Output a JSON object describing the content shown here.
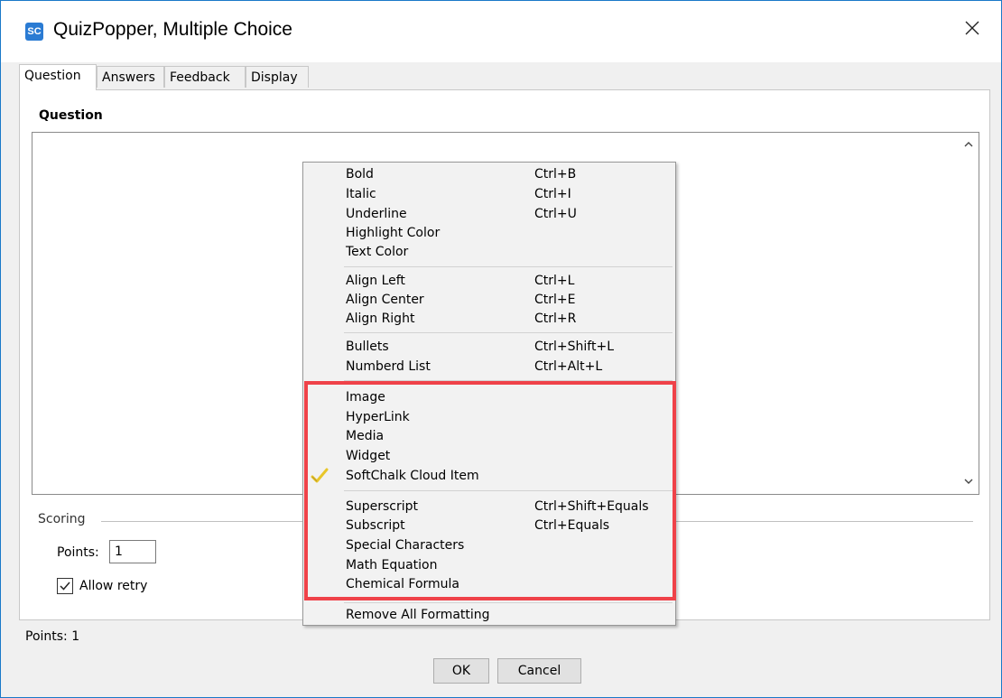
{
  "window": {
    "title": "QuizPopper, Multiple Choice",
    "app_icon_text": "SC"
  },
  "tabs": [
    {
      "label": "Question",
      "active": true
    },
    {
      "label": "Answers",
      "active": false
    },
    {
      "label": "Feedback",
      "active": false
    },
    {
      "label": "Display",
      "active": false
    }
  ],
  "question": {
    "heading": "Question"
  },
  "context_menu": {
    "groups": [
      [
        {
          "label": "Bold",
          "shortcut": "Ctrl+B"
        },
        {
          "label": "Italic",
          "shortcut": "Ctrl+I"
        },
        {
          "label": "Underline",
          "shortcut": "Ctrl+U"
        },
        {
          "label": "Highlight Color",
          "shortcut": ""
        },
        {
          "label": "Text Color",
          "shortcut": ""
        }
      ],
      [
        {
          "label": "Align Left",
          "shortcut": "Ctrl+L"
        },
        {
          "label": "Align Center",
          "shortcut": "Ctrl+E"
        },
        {
          "label": "Align Right",
          "shortcut": "Ctrl+R"
        }
      ],
      [
        {
          "label": "Bullets",
          "shortcut": "Ctrl+Shift+L"
        },
        {
          "label": "Numberd List",
          "shortcut": "Ctrl+Alt+L"
        }
      ],
      [
        {
          "label": "Image",
          "shortcut": ""
        },
        {
          "label": "HyperLink",
          "shortcut": ""
        },
        {
          "label": "Media",
          "shortcut": ""
        },
        {
          "label": "Widget",
          "shortcut": ""
        },
        {
          "label": "SoftChalk Cloud Item",
          "shortcut": "",
          "icon": "cloud-check-icon"
        }
      ],
      [
        {
          "label": "Superscript",
          "shortcut": "Ctrl+Shift+Equals"
        },
        {
          "label": "Subscript",
          "shortcut": "Ctrl+Equals"
        },
        {
          "label": "Special Characters",
          "shortcut": ""
        },
        {
          "label": "Math Equation",
          "shortcut": ""
        },
        {
          "label": "Chemical Formula",
          "shortcut": ""
        }
      ],
      [
        {
          "label": "Remove All Formatting",
          "shortcut": ""
        }
      ]
    ]
  },
  "scoring": {
    "legend": "Scoring",
    "points_label": "Points:",
    "points_value": "1",
    "allow_retry_label": "Allow retry",
    "allow_retry_checked": true
  },
  "status": {
    "text": "Points: 1"
  },
  "buttons": {
    "ok": "OK",
    "cancel": "Cancel"
  },
  "colors": {
    "highlight_border": "#ef4249",
    "window_border": "#1a79c9",
    "app_icon": "#2a7bd3"
  }
}
